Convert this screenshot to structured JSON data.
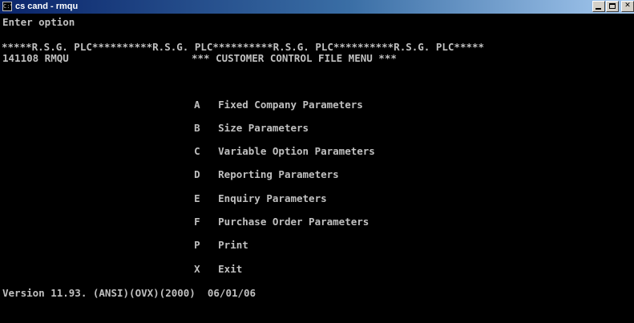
{
  "window": {
    "title": "cs cand - rmqu",
    "icon": "console-icon",
    "buttons": [
      "minimize",
      "maximize",
      "close"
    ]
  },
  "console": {
    "prompt": "Enter option",
    "banner": "*****R.S.G. PLC**********R.S.G. PLC**********R.S.G. PLC**********R.S.G. PLC*****",
    "header_left": "141108 RMQU",
    "menu_title": "*** CUSTOMER CONTROL FILE MENU ***",
    "menu_items": [
      {
        "key": "A",
        "label": "Fixed Company Parameters"
      },
      {
        "key": "B",
        "label": "Size Parameters"
      },
      {
        "key": "C",
        "label": "Variable Option Parameters"
      },
      {
        "key": "D",
        "label": "Reporting Parameters"
      },
      {
        "key": "E",
        "label": "Enquiry Parameters"
      },
      {
        "key": "F",
        "label": "Purchase Order Parameters"
      },
      {
        "key": "P",
        "label": "Print"
      },
      {
        "key": "X",
        "label": "Exit"
      }
    ],
    "version": "Version 11.93. (ANSI)(OVX)(2000)  06/01/06"
  },
  "colors": {
    "background": "#000000",
    "text": "#c0c0c0",
    "titlebar_start": "#0a246a",
    "titlebar_end": "#a6caf0"
  }
}
